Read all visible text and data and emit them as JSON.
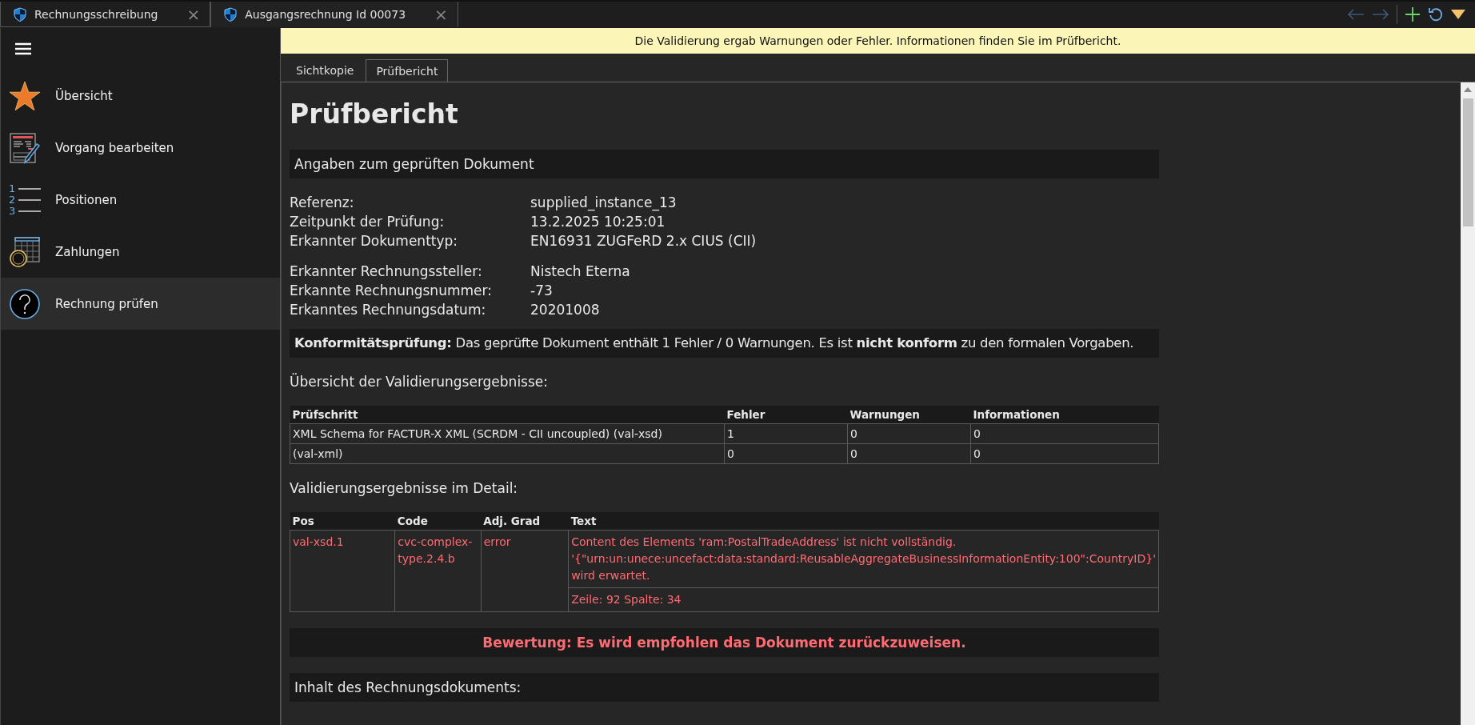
{
  "window_tabs": [
    {
      "title": "Rechnungsschreibung",
      "selected": false,
      "close": "×"
    },
    {
      "title": "Ausgangsrechnung Id 00073",
      "selected": true,
      "close": "×"
    }
  ],
  "sidebar": {
    "items": [
      {
        "label": "Übersicht",
        "selected": false
      },
      {
        "label": "Vorgang bearbeiten",
        "selected": false
      },
      {
        "label": "Positionen",
        "selected": false,
        "icon_numbers": [
          "1",
          "2",
          "3"
        ]
      },
      {
        "label": "Zahlungen",
        "selected": false
      },
      {
        "label": "Rechnung prüfen",
        "selected": true
      }
    ]
  },
  "banner": "Die Validierung ergab Warnungen oder Fehler. Informationen finden Sie im Prüfbericht.",
  "view_tabs": [
    {
      "label": "Sichtkopie",
      "selected": false
    },
    {
      "label": "Prüfbericht",
      "selected": true
    }
  ],
  "report": {
    "title": "Prüfbericht",
    "document_section": "Angaben zum geprüften Dokument",
    "details": [
      [
        {
          "label": "Referenz:",
          "value": "supplied_instance_13"
        },
        {
          "label": "Zeitpunkt der Prüfung:",
          "value": "13.2.2025 10:25:01"
        },
        {
          "label": "Erkannter Dokumenttyp:",
          "value": "EN16931 ZUGFeRD 2.x CIUS (CII)"
        }
      ],
      [
        {
          "label": "Erkannter Rechnungssteller:",
          "value": "Nistech Eterna"
        },
        {
          "label": "Erkannte Rechnungsnummer:",
          "value": "-73"
        },
        {
          "label": "Erkanntes Rechnungsdatum:",
          "value": "20201008"
        }
      ]
    ],
    "conformity": "**Konformitätsprüfung:** Das geprüfte Dokument enthält 1 Fehler / 0 Warnungen. Es ist **nicht konform** zu den formalen Vorgaben.",
    "summary_heading": "Übersicht der Validierungsergebnisse:",
    "summary_table": {
      "columns": [
        "Prüfschritt",
        "Fehler",
        "Warnungen",
        "Informationen"
      ],
      "rows": [
        [
          "XML Schema for FACTUR-X XML (SCRDM - CII uncoupled) (val-xsd)",
          "1",
          "0",
          "0"
        ],
        [
          "(val-xml)",
          "0",
          "0",
          "0"
        ]
      ]
    },
    "detail_heading": "Validierungsergebnisse im Detail:",
    "detail_table": {
      "columns": [
        "Pos",
        "Code",
        "Adj. Grad",
        "Text"
      ],
      "rows": [
        {
          "pos": "val-xsd.1",
          "code": "cvc-complex-type.2.4.b",
          "grade": "error",
          "text": "Content des Elements 'ram:PostalTradeAddress' ist nicht vollständig. '{\"urn:un:unece:uncefact:data:standard:ReusableAggregateBusinessInformationEntity:100\":CountryID}' wird erwartet.",
          "location": "Zeile: 92 Spalte: 34"
        }
      ]
    },
    "verdict": "Bewertung: Es wird empfohlen das Dokument zurückzuweisen.",
    "content_section": "Inhalt des Rechnungsdokuments:"
  }
}
